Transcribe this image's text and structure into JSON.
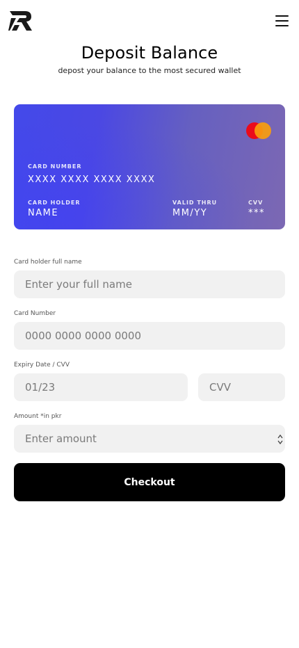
{
  "header": {
    "logo_icon": "r-logo-icon",
    "menu_icon": "hamburger-menu-icon"
  },
  "page": {
    "title": "Deposit Balance",
    "subtitle": "depost your balance to the most secured wallet"
  },
  "card_preview": {
    "brand_icon": "mastercard-logo-icon",
    "number_label": "CARD NUMBER",
    "number_value": "XXXX XXXX XXXX XXXX",
    "holder_label": "CARD HOLDER",
    "holder_value": "NAME",
    "valid_label": "VALID THRU",
    "valid_value": "MM/YY",
    "cvv_label": "CVV",
    "cvv_value": "***",
    "gradient_colors": [
      "#4349ea",
      "#7c68b3"
    ]
  },
  "form": {
    "name_label": "Card holder full name",
    "name_placeholder": "Enter your full name",
    "number_label": "Card Number",
    "number_placeholder": "0000 0000 0000 0000",
    "expiry_label": "Expiry Date / CVV",
    "expiry_placeholder": "01/23",
    "cvv_placeholder": "CVV",
    "amount_label": "Amount *in pkr",
    "amount_placeholder": "Enter amount",
    "checkout_label": "Checkout"
  }
}
